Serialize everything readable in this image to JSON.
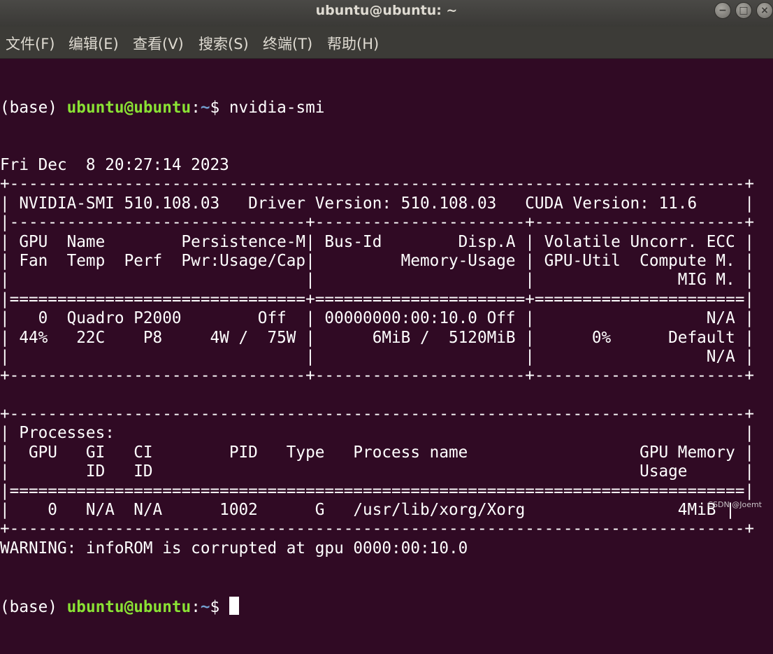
{
  "window": {
    "title": "ubuntu@ubuntu: ~",
    "minimize_icon": "minimize-icon",
    "maximize_icon": "maximize-icon",
    "close_icon": "close-icon"
  },
  "menu": {
    "items": [
      "文件(F)",
      "编辑(E)",
      "查看(V)",
      "搜索(S)",
      "终端(T)",
      "帮助(H)"
    ]
  },
  "prompt": {
    "env": "(base) ",
    "user_host": "ubuntu@ubuntu",
    "sep": ":",
    "path": "~",
    "symbol": "$ "
  },
  "command": "nvidia-smi",
  "output": [
    "Fri Dec  8 20:27:14 2023",
    "+-----------------------------------------------------------------------------+",
    "| NVIDIA-SMI 510.108.03   Driver Version: 510.108.03   CUDA Version: 11.6     |",
    "|-------------------------------+----------------------+----------------------+",
    "| GPU  Name        Persistence-M| Bus-Id        Disp.A | Volatile Uncorr. ECC |",
    "| Fan  Temp  Perf  Pwr:Usage/Cap|         Memory-Usage | GPU-Util  Compute M. |",
    "|                               |                      |               MIG M. |",
    "|===============================+======================+======================|",
    "|   0  Quadro P2000        Off  | 00000000:00:10.0 Off |                  N/A |",
    "| 44%   22C    P8     4W /  75W |      6MiB /  5120MiB |      0%      Default |",
    "|                               |                      |                  N/A |",
    "+-------------------------------+----------------------+----------------------+",
    "",
    "+-----------------------------------------------------------------------------+",
    "| Processes:                                                                  |",
    "|  GPU   GI   CI        PID   Type   Process name                  GPU Memory |",
    "|        ID   ID                                                   Usage      |",
    "|=============================================================================|",
    "|    0   N/A  N/A      1002      G   /usr/lib/xorg/Xorg                4MiB |",
    "+-----------------------------------------------------------------------------+",
    "WARNING: infoROM is corrupted at gpu 0000:00:10.0"
  ],
  "watermark": "CSDN @Joemt",
  "colors": {
    "background": "#300a24",
    "text": "#ffffff",
    "user_host": "#8ae234",
    "path": "#729fcf"
  }
}
